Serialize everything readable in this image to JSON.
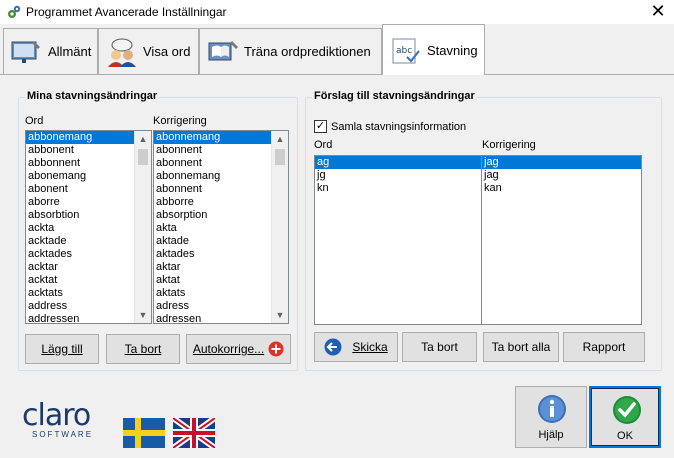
{
  "window": {
    "title": "Programmet Avancerade Inställningar",
    "close_symbol": "✕"
  },
  "tabs": [
    {
      "label": "Allmänt",
      "icon": "settings-monitor-icon",
      "active": false
    },
    {
      "label": "Visa ord",
      "icon": "people-speech-icon",
      "active": false
    },
    {
      "label": "Träna ordprediktionen",
      "icon": "training-book-icon",
      "active": false
    },
    {
      "label": "Stavning",
      "icon": "abc-spelling-icon",
      "active": true
    }
  ],
  "left_group": {
    "title": "Mina stavningsändringar",
    "col_word": "Ord",
    "col_correction": "Korrigering",
    "words": [
      "abbonemang",
      "abbonent",
      "abbonnent",
      "abonemang",
      "abonent",
      "aborre",
      "absorbtion",
      "ackta",
      "acktade",
      "acktades",
      "acktar",
      "acktat",
      "acktats",
      "address",
      "addressen"
    ],
    "corrections": [
      "abonnemang",
      "abonnent",
      "abonnent",
      "abonnemang",
      "abonnent",
      "abborre",
      "absorption",
      "akta",
      "aktade",
      "aktades",
      "aktar",
      "aktat",
      "aktats",
      "adress",
      "adressen"
    ],
    "buttons": {
      "add": "Lägg till",
      "remove": "Ta bort",
      "autocorrect": "Autokorrige..."
    }
  },
  "right_group": {
    "title": "Förslag till stavningsändringar",
    "checkbox_label": "Samla stavningsinformation",
    "checkbox_checked": true,
    "checkmark": "✓",
    "col_word": "Ord",
    "col_correction": "Korrigering",
    "words": [
      "ag",
      "jg",
      "kn"
    ],
    "corrections": [
      "jag",
      "jag",
      "kan"
    ],
    "buttons": {
      "send": "Skicka",
      "remove": "Ta bort",
      "remove_all": "Ta bort alla",
      "report": "Rapport"
    }
  },
  "footer": {
    "logo_text": "claro",
    "logo_sub": "SOFTWARE",
    "help_label": "Hjälp",
    "ok_label": "OK"
  },
  "colors": {
    "selection": "#0078d7",
    "button_bg": "#e1e1e1",
    "claro_blue": "#1b3a6b",
    "ok_green": "#2ea84a"
  }
}
